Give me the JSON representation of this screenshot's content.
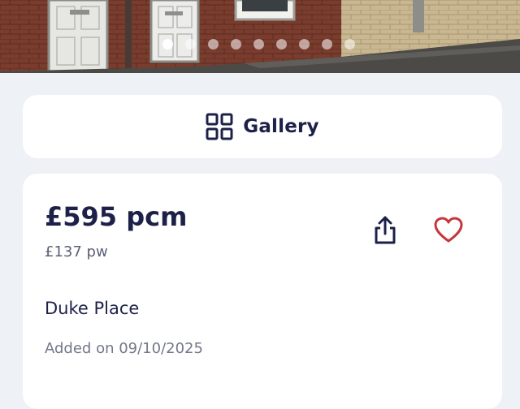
{
  "carousel": {
    "total_images": 9,
    "active_index": 0
  },
  "gallery": {
    "label": "Gallery",
    "icon": "grid-icon"
  },
  "listing": {
    "price_monthly": "£595 pcm",
    "price_weekly": "£137 pw",
    "address": "Duke Place",
    "added": "Added on 09/10/2025"
  },
  "actions": {
    "share_icon": "share-icon",
    "favourite_icon": "heart-icon"
  },
  "colors": {
    "brand_navy": "#1d2148",
    "heart_red": "#c8363d",
    "page_background": "#eef1f5"
  }
}
